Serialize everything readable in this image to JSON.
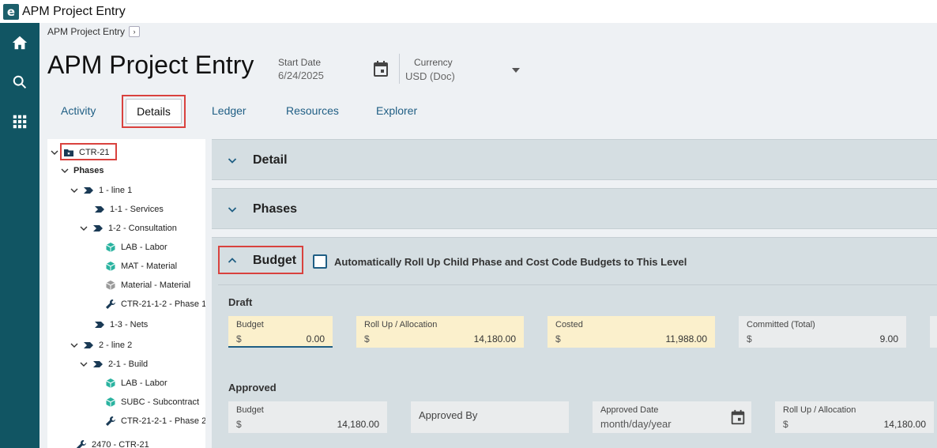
{
  "app": {
    "logo": "e",
    "title": "APM Project Entry"
  },
  "rail": {
    "items": [
      "home-icon",
      "search-icon",
      "apps-grid-icon"
    ]
  },
  "breadcrumb": {
    "label": "APM Project Entry",
    "arrow": "›"
  },
  "header": {
    "title": "APM Project Entry",
    "start_date_label": "Start Date",
    "start_date_value": "6/24/2025",
    "currency_label": "Currency",
    "currency_value": "USD (Doc)"
  },
  "tabs": [
    {
      "label": "Activity"
    },
    {
      "label": "Details",
      "selected": true
    },
    {
      "label": "Ledger"
    },
    {
      "label": "Resources"
    },
    {
      "label": "Explorer"
    }
  ],
  "tree": {
    "root": "CTR-21",
    "phases": "Phases",
    "items": [
      "1 - line 1",
      "1-1 - Services",
      "1-2 - Consultation",
      "LAB - Labor",
      "MAT - Material",
      "Material - Material",
      "CTR-21-1-2 - Phase 1-",
      "1-3 - Nets",
      "2 - line 2",
      "2-1 - Build",
      "LAB - Labor",
      "SUBC - Subcontract",
      "CTR-21-2-1 - Phase 2-",
      "2470 - CTR-21"
    ]
  },
  "sections": {
    "detail": "Detail",
    "phases": "Phases",
    "budget": "Budget",
    "rollup_label": "Automatically Roll Up Child Phase and Cost Code Budgets to This Level"
  },
  "draft": {
    "title": "Draft",
    "fields": [
      {
        "label": "Budget",
        "currency": "$",
        "value": "0.00"
      },
      {
        "label": "Roll Up / Allocation",
        "currency": "$",
        "value": "14,180.00"
      },
      {
        "label": "Costed",
        "currency": "$",
        "value": "11,988.00"
      },
      {
        "label": "Committed (Total)",
        "currency": "$",
        "value": "9.00"
      }
    ]
  },
  "approved": {
    "title": "Approved",
    "budget": {
      "label": "Budget",
      "currency": "$",
      "value": "14,180.00"
    },
    "approved_by": {
      "label": "Approved By"
    },
    "approved_date": {
      "label": "Approved Date",
      "placeholder": "month/day/year"
    },
    "rollup": {
      "label": "Roll Up / Allocation",
      "currency": "$",
      "value": "14,180.00"
    }
  },
  "colors": {
    "rail": "#115563",
    "accent": "#1f5e84",
    "highlight": "#d9423e",
    "section": "#d5dee2",
    "draft_field": "#fbf0cc"
  }
}
